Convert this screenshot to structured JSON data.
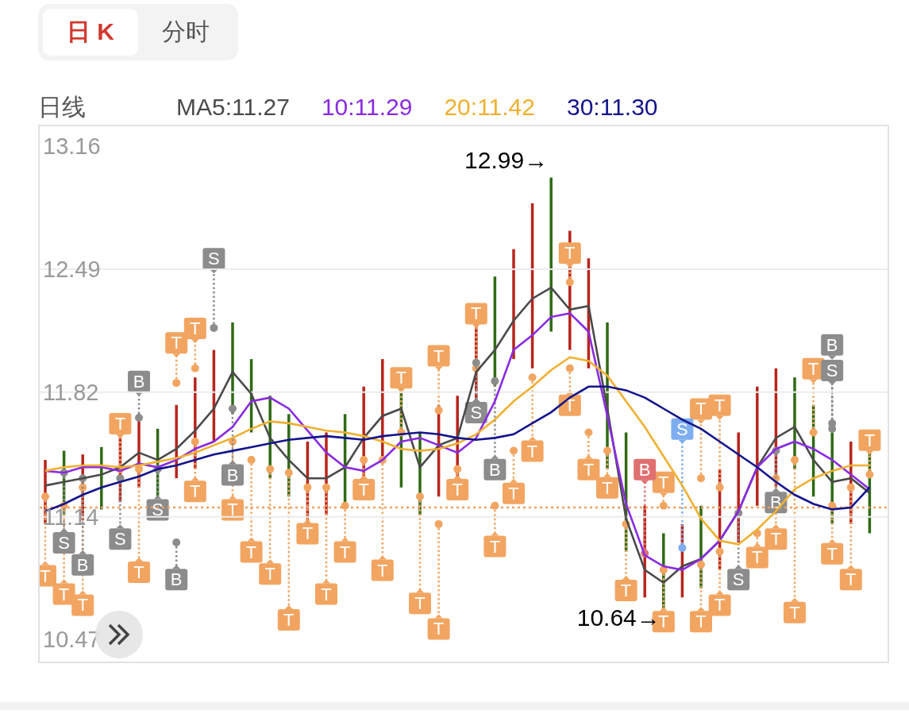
{
  "tabs": [
    {
      "label": "日 K",
      "selected": true
    },
    {
      "label": "分时",
      "selected": false
    }
  ],
  "chart": {
    "title": "日线",
    "chart_data": {
      "type": "line",
      "ylim": [
        10.35,
        13.27
      ],
      "grid": true,
      "yticks": [
        {
          "value": 13.16,
          "label": "13.16"
        },
        {
          "value": 12.49,
          "label": "12.49"
        },
        {
          "value": 11.82,
          "label": "11.82"
        },
        {
          "value": 11.14,
          "label": "11.14"
        },
        {
          "value": 10.47,
          "label": "10.47"
        }
      ],
      "series": [
        {
          "name": "MA5:11.27",
          "color": "#4a4a4a",
          "values": [
            11.31,
            11.33,
            11.35,
            11.37,
            11.41,
            11.49,
            11.45,
            11.51,
            11.61,
            11.73,
            11.93,
            11.81,
            11.57,
            11.45,
            11.35,
            11.35,
            11.41,
            11.57,
            11.69,
            11.73,
            11.41,
            11.53,
            11.57,
            11.93,
            12.05,
            12.21,
            12.33,
            12.39,
            12.27,
            12.29,
            11.73,
            11.13,
            10.85,
            10.78,
            10.87,
            10.91,
            11.01,
            11.17,
            11.41,
            11.57,
            11.63,
            11.45,
            11.33,
            11.35,
            11.27
          ]
        },
        {
          "name": "10:11.29",
          "color": "#8a2be2",
          "values": [
            11.39,
            11.38,
            11.41,
            11.41,
            11.39,
            11.43,
            11.41,
            11.45,
            11.51,
            11.55,
            11.63,
            11.77,
            11.79,
            11.73,
            11.61,
            11.49,
            11.41,
            11.39,
            11.45,
            11.55,
            11.57,
            11.53,
            11.49,
            11.57,
            11.77,
            12.05,
            12.13,
            12.23,
            12.25,
            12.15,
            11.69,
            11.21,
            10.93,
            10.87,
            10.85,
            10.91,
            11.01,
            11.17,
            11.41,
            11.51,
            11.55,
            11.51,
            11.45,
            11.37,
            11.29
          ]
        },
        {
          "name": "20:11.42",
          "color": "#f0b030",
          "values": [
            11.39,
            11.41,
            11.42,
            11.42,
            11.41,
            11.42,
            11.44,
            11.46,
            11.49,
            11.53,
            11.57,
            11.62,
            11.66,
            11.65,
            11.63,
            11.61,
            11.6,
            11.58,
            11.55,
            11.51,
            11.5,
            11.51,
            11.54,
            11.59,
            11.67,
            11.77,
            11.85,
            11.94,
            12.01,
            11.99,
            11.91,
            11.77,
            11.63,
            11.47,
            11.31,
            11.13,
            11.01,
            10.99,
            11.07,
            11.17,
            11.29,
            11.35,
            11.39,
            11.42,
            11.42
          ]
        },
        {
          "name": "30:11.30",
          "color": "#14148c",
          "values": [
            11.17,
            11.21,
            11.26,
            11.3,
            11.33,
            11.36,
            11.4,
            11.42,
            11.45,
            11.48,
            11.5,
            11.52,
            11.54,
            11.56,
            11.57,
            11.58,
            11.57,
            11.56,
            11.58,
            11.59,
            11.6,
            11.59,
            11.57,
            11.56,
            11.57,
            11.59,
            11.65,
            11.71,
            11.79,
            11.85,
            11.85,
            11.83,
            11.79,
            11.73,
            11.67,
            11.62,
            11.55,
            11.48,
            11.41,
            11.33,
            11.26,
            11.21,
            11.18,
            11.19,
            11.3
          ]
        }
      ],
      "ref_lines": [
        {
          "axis": "y",
          "value": 11.19,
          "color": "#f0a060"
        }
      ],
      "annotations": [
        {
          "text": "12.99→"
        },
        {
          "text": "10.64→"
        }
      ]
    },
    "markers": [
      {
        "label": "T",
        "color": "#f2a561"
      },
      {
        "label": "T",
        "color": "#f2a561"
      },
      {
        "label": "T",
        "color": "#f2a561"
      },
      {
        "label": "T",
        "color": "#f2a561"
      },
      {
        "label": "T",
        "color": "#f2a561"
      },
      {
        "label": "T",
        "color": "#f2a561"
      },
      {
        "label": "T",
        "color": "#f2a561"
      },
      {
        "label": "T",
        "color": "#f2a561"
      },
      {
        "label": "T",
        "color": "#f2a561"
      },
      {
        "label": "T",
        "color": "#f2a561"
      },
      {
        "label": "T",
        "color": "#f2a561"
      },
      {
        "label": "T",
        "color": "#f2a561"
      },
      {
        "label": "T",
        "color": "#f2a561"
      },
      {
        "label": "T",
        "color": "#f2a561"
      },
      {
        "label": "T",
        "color": "#f2a561"
      },
      {
        "label": "T",
        "color": "#f2a561"
      },
      {
        "label": "T",
        "color": "#f2a561"
      },
      {
        "label": "T",
        "color": "#f2a561"
      },
      {
        "label": "T",
        "color": "#f2a561"
      },
      {
        "label": "T",
        "color": "#f2a561"
      },
      {
        "label": "T",
        "color": "#f2a561"
      },
      {
        "label": "T",
        "color": "#f2a561"
      },
      {
        "label": "T",
        "color": "#f2a561"
      },
      {
        "label": "T",
        "color": "#f2a561"
      },
      {
        "label": "T",
        "color": "#f2a561"
      },
      {
        "label": "T",
        "color": "#f2a561"
      },
      {
        "label": "T",
        "color": "#f2a561"
      },
      {
        "label": "T",
        "color": "#f2a561"
      },
      {
        "label": "T",
        "color": "#f2a561"
      },
      {
        "label": "T",
        "color": "#f2a561"
      },
      {
        "label": "T",
        "color": "#f2a561"
      },
      {
        "label": "T",
        "color": "#f2a561"
      },
      {
        "label": "T",
        "color": "#f2a561"
      },
      {
        "label": "T",
        "color": "#f2a561"
      },
      {
        "label": "T",
        "color": "#f2a561"
      },
      {
        "label": "T",
        "color": "#f2a561"
      },
      {
        "label": "T",
        "color": "#f2a561"
      },
      {
        "label": "T",
        "color": "#f2a561"
      },
      {
        "label": "T",
        "color": "#f2a561"
      },
      {
        "label": "T",
        "color": "#f2a561"
      },
      {
        "label": "T",
        "color": "#f2a561"
      },
      {
        "label": "T",
        "color": "#f2a561"
      },
      {
        "label": "T",
        "color": "#f2a561"
      },
      {
        "label": "T",
        "color": "#f2a561"
      },
      {
        "label": "S",
        "color": "#8c8c8c"
      },
      {
        "label": "B",
        "color": "#8c8c8c"
      },
      {
        "label": "B",
        "color": "#8c8c8c"
      },
      {
        "label": "S",
        "color": "#8c8c8c"
      },
      {
        "label": "B",
        "color": "#8c8c8c"
      },
      {
        "label": "S",
        "color": "#8c8c8c"
      },
      {
        "label": "B",
        "color": "#8c8c8c"
      },
      {
        "label": "S",
        "color": "#8c8c8c"
      },
      {
        "label": "S",
        "color": "#8c8c8c"
      },
      {
        "label": "B",
        "color": "#8c8c8c"
      },
      {
        "label": "B",
        "color": "#e07070"
      },
      {
        "label": "S",
        "color": "#7eaef0"
      },
      {
        "label": "S",
        "color": "#8c8c8c"
      },
      {
        "label": "B",
        "color": "#8c8c8c"
      },
      {
        "label": "B",
        "color": "#8c8c8c"
      },
      {
        "label": "S",
        "color": "#8c8c8c"
      }
    ]
  }
}
